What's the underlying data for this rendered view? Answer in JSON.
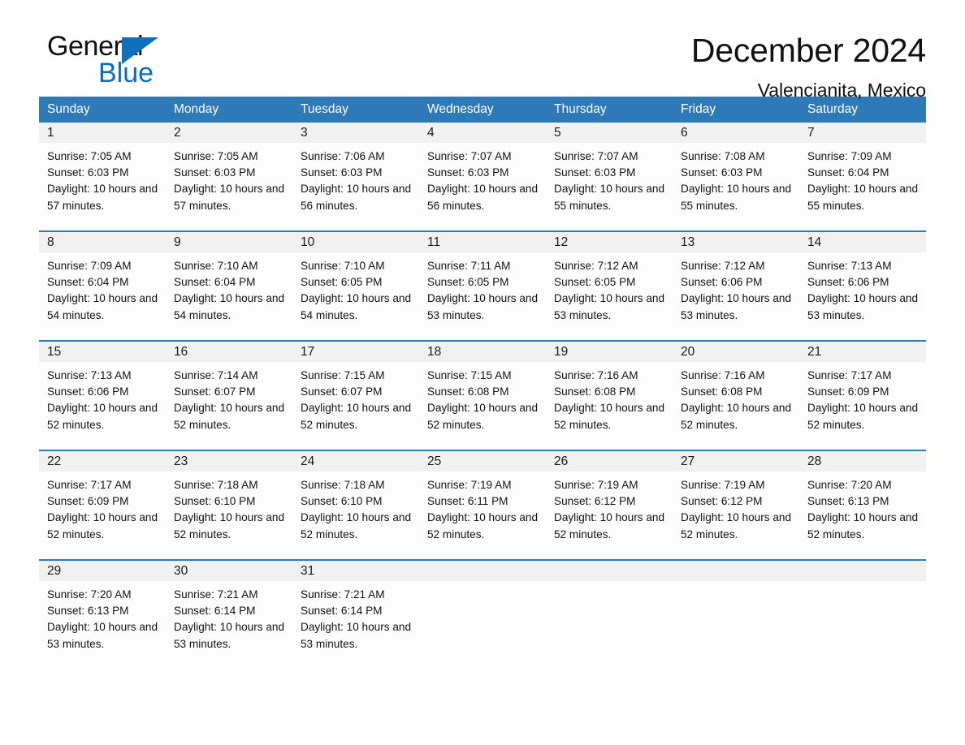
{
  "brand": {
    "name_part1": "General",
    "name_part2": "Blue",
    "accent_color": "#0d6fbe",
    "triangle_icon": "triangle-logo-icon"
  },
  "header": {
    "title": "December 2024",
    "subtitle": "Valencianita, Mexico"
  },
  "calendar": {
    "header_bg": "#2e79b8",
    "daynum_bg": "#f1f1f1",
    "weekdays": [
      "Sunday",
      "Monday",
      "Tuesday",
      "Wednesday",
      "Thursday",
      "Friday",
      "Saturday"
    ],
    "weeks": [
      {
        "days": [
          {
            "num": "1",
            "sunrise": "Sunrise: 7:05 AM",
            "sunset": "Sunset: 6:03 PM",
            "daylight": "Daylight: 10 hours and 57 minutes."
          },
          {
            "num": "2",
            "sunrise": "Sunrise: 7:05 AM",
            "sunset": "Sunset: 6:03 PM",
            "daylight": "Daylight: 10 hours and 57 minutes."
          },
          {
            "num": "3",
            "sunrise": "Sunrise: 7:06 AM",
            "sunset": "Sunset: 6:03 PM",
            "daylight": "Daylight: 10 hours and 56 minutes."
          },
          {
            "num": "4",
            "sunrise": "Sunrise: 7:07 AM",
            "sunset": "Sunset: 6:03 PM",
            "daylight": "Daylight: 10 hours and 56 minutes."
          },
          {
            "num": "5",
            "sunrise": "Sunrise: 7:07 AM",
            "sunset": "Sunset: 6:03 PM",
            "daylight": "Daylight: 10 hours and 55 minutes."
          },
          {
            "num": "6",
            "sunrise": "Sunrise: 7:08 AM",
            "sunset": "Sunset: 6:03 PM",
            "daylight": "Daylight: 10 hours and 55 minutes."
          },
          {
            "num": "7",
            "sunrise": "Sunrise: 7:09 AM",
            "sunset": "Sunset: 6:04 PM",
            "daylight": "Daylight: 10 hours and 55 minutes."
          }
        ]
      },
      {
        "days": [
          {
            "num": "8",
            "sunrise": "Sunrise: 7:09 AM",
            "sunset": "Sunset: 6:04 PM",
            "daylight": "Daylight: 10 hours and 54 minutes."
          },
          {
            "num": "9",
            "sunrise": "Sunrise: 7:10 AM",
            "sunset": "Sunset: 6:04 PM",
            "daylight": "Daylight: 10 hours and 54 minutes."
          },
          {
            "num": "10",
            "sunrise": "Sunrise: 7:10 AM",
            "sunset": "Sunset: 6:05 PM",
            "daylight": "Daylight: 10 hours and 54 minutes."
          },
          {
            "num": "11",
            "sunrise": "Sunrise: 7:11 AM",
            "sunset": "Sunset: 6:05 PM",
            "daylight": "Daylight: 10 hours and 53 minutes."
          },
          {
            "num": "12",
            "sunrise": "Sunrise: 7:12 AM",
            "sunset": "Sunset: 6:05 PM",
            "daylight": "Daylight: 10 hours and 53 minutes."
          },
          {
            "num": "13",
            "sunrise": "Sunrise: 7:12 AM",
            "sunset": "Sunset: 6:06 PM",
            "daylight": "Daylight: 10 hours and 53 minutes."
          },
          {
            "num": "14",
            "sunrise": "Sunrise: 7:13 AM",
            "sunset": "Sunset: 6:06 PM",
            "daylight": "Daylight: 10 hours and 53 minutes."
          }
        ]
      },
      {
        "days": [
          {
            "num": "15",
            "sunrise": "Sunrise: 7:13 AM",
            "sunset": "Sunset: 6:06 PM",
            "daylight": "Daylight: 10 hours and 52 minutes."
          },
          {
            "num": "16",
            "sunrise": "Sunrise: 7:14 AM",
            "sunset": "Sunset: 6:07 PM",
            "daylight": "Daylight: 10 hours and 52 minutes."
          },
          {
            "num": "17",
            "sunrise": "Sunrise: 7:15 AM",
            "sunset": "Sunset: 6:07 PM",
            "daylight": "Daylight: 10 hours and 52 minutes."
          },
          {
            "num": "18",
            "sunrise": "Sunrise: 7:15 AM",
            "sunset": "Sunset: 6:08 PM",
            "daylight": "Daylight: 10 hours and 52 minutes."
          },
          {
            "num": "19",
            "sunrise": "Sunrise: 7:16 AM",
            "sunset": "Sunset: 6:08 PM",
            "daylight": "Daylight: 10 hours and 52 minutes."
          },
          {
            "num": "20",
            "sunrise": "Sunrise: 7:16 AM",
            "sunset": "Sunset: 6:08 PM",
            "daylight": "Daylight: 10 hours and 52 minutes."
          },
          {
            "num": "21",
            "sunrise": "Sunrise: 7:17 AM",
            "sunset": "Sunset: 6:09 PM",
            "daylight": "Daylight: 10 hours and 52 minutes."
          }
        ]
      },
      {
        "days": [
          {
            "num": "22",
            "sunrise": "Sunrise: 7:17 AM",
            "sunset": "Sunset: 6:09 PM",
            "daylight": "Daylight: 10 hours and 52 minutes."
          },
          {
            "num": "23",
            "sunrise": "Sunrise: 7:18 AM",
            "sunset": "Sunset: 6:10 PM",
            "daylight": "Daylight: 10 hours and 52 minutes."
          },
          {
            "num": "24",
            "sunrise": "Sunrise: 7:18 AM",
            "sunset": "Sunset: 6:10 PM",
            "daylight": "Daylight: 10 hours and 52 minutes."
          },
          {
            "num": "25",
            "sunrise": "Sunrise: 7:19 AM",
            "sunset": "Sunset: 6:11 PM",
            "daylight": "Daylight: 10 hours and 52 minutes."
          },
          {
            "num": "26",
            "sunrise": "Sunrise: 7:19 AM",
            "sunset": "Sunset: 6:12 PM",
            "daylight": "Daylight: 10 hours and 52 minutes."
          },
          {
            "num": "27",
            "sunrise": "Sunrise: 7:19 AM",
            "sunset": "Sunset: 6:12 PM",
            "daylight": "Daylight: 10 hours and 52 minutes."
          },
          {
            "num": "28",
            "sunrise": "Sunrise: 7:20 AM",
            "sunset": "Sunset: 6:13 PM",
            "daylight": "Daylight: 10 hours and 52 minutes."
          }
        ]
      },
      {
        "days": [
          {
            "num": "29",
            "sunrise": "Sunrise: 7:20 AM",
            "sunset": "Sunset: 6:13 PM",
            "daylight": "Daylight: 10 hours and 53 minutes."
          },
          {
            "num": "30",
            "sunrise": "Sunrise: 7:21 AM",
            "sunset": "Sunset: 6:14 PM",
            "daylight": "Daylight: 10 hours and 53 minutes."
          },
          {
            "num": "31",
            "sunrise": "Sunrise: 7:21 AM",
            "sunset": "Sunset: 6:14 PM",
            "daylight": "Daylight: 10 hours and 53 minutes."
          },
          {
            "num": "",
            "sunrise": "",
            "sunset": "",
            "daylight": ""
          },
          {
            "num": "",
            "sunrise": "",
            "sunset": "",
            "daylight": ""
          },
          {
            "num": "",
            "sunrise": "",
            "sunset": "",
            "daylight": ""
          },
          {
            "num": "",
            "sunrise": "",
            "sunset": "",
            "daylight": ""
          }
        ]
      }
    ]
  }
}
